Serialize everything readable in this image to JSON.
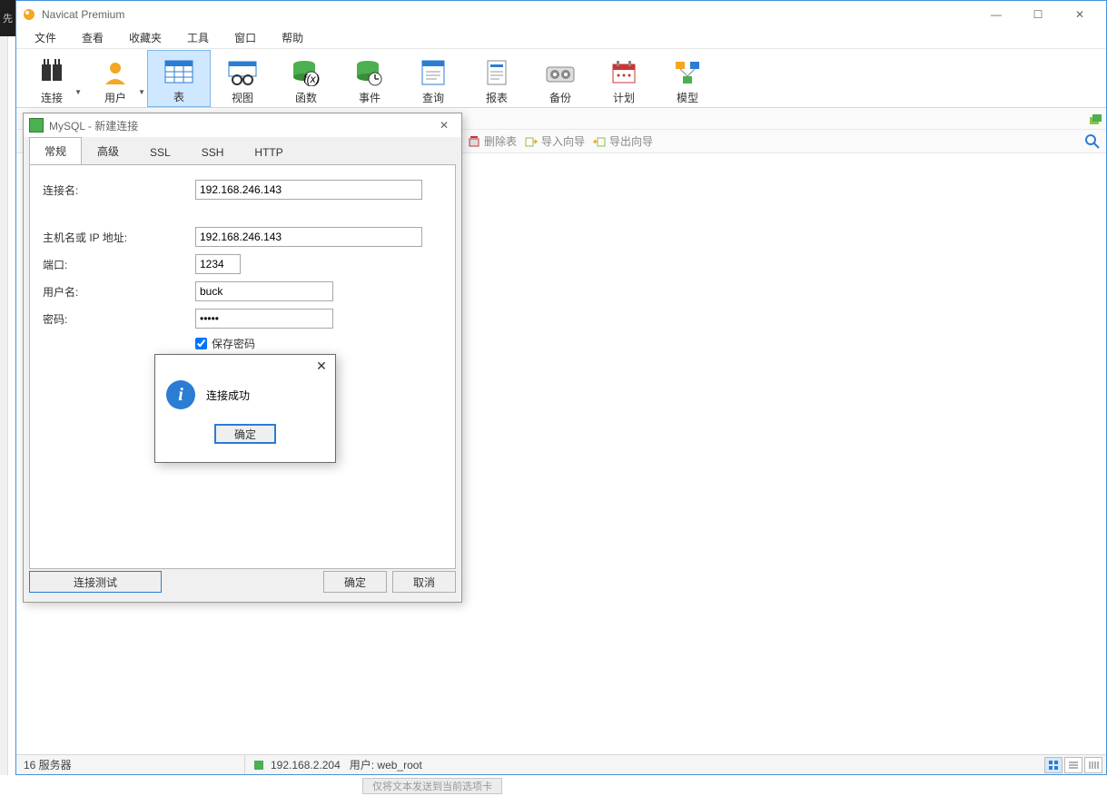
{
  "app": {
    "title": "Navicat Premium"
  },
  "win": {
    "min": "—",
    "max": "☐",
    "close": "✕"
  },
  "menu": [
    "文件",
    "查看",
    "收藏夹",
    "工具",
    "窗口",
    "帮助"
  ],
  "tools": [
    {
      "label": "连接",
      "drop": true
    },
    {
      "label": "用户",
      "drop": true
    },
    {
      "label": "表",
      "drop": false,
      "sel": true
    },
    {
      "label": "视图"
    },
    {
      "label": "函数"
    },
    {
      "label": "事件"
    },
    {
      "label": "查询"
    },
    {
      "label": "报表"
    },
    {
      "label": "备份"
    },
    {
      "label": "计划"
    },
    {
      "label": "模型"
    }
  ],
  "actions": {
    "delete": "删除表",
    "importwiz": "导入向导",
    "exportwiz": "导出向导"
  },
  "dlg": {
    "title": "MySQL - 新建连接",
    "tabs": [
      "常规",
      "高级",
      "SSL",
      "SSH",
      "HTTP"
    ],
    "labels": {
      "conn": "连接名:",
      "host": "主机名或 IP 地址:",
      "port": "端口:",
      "user": "用户名:",
      "pass": "密码:",
      "save": "保存密码"
    },
    "values": {
      "conn": "192.168.246.143",
      "host": "192.168.246.143",
      "port": "1234",
      "user": "buck",
      "pass": "•••••"
    },
    "buttons": {
      "test": "连接测试",
      "ok": "确定",
      "cancel": "取消"
    }
  },
  "msg": {
    "text": "连接成功",
    "ok": "确定",
    "close": "✕"
  },
  "status": {
    "servers": "16 服务器",
    "ip": "192.168.2.204",
    "user": "用户: web_root"
  },
  "ghost": "仅将文本发送到当前选项卡",
  "leftchar": "先"
}
